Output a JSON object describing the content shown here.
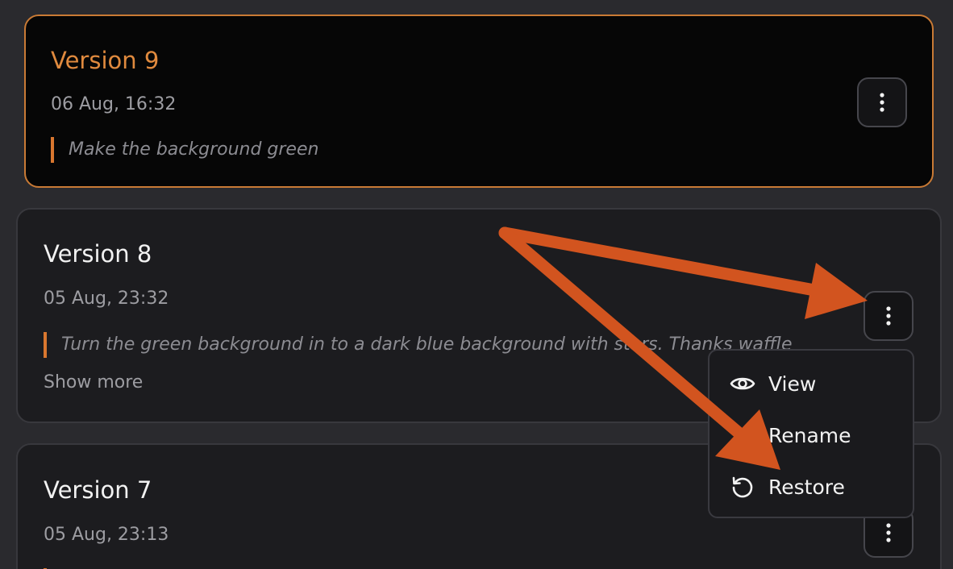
{
  "versions": [
    {
      "title": "Version 9",
      "date": "06 Aug, 16:32",
      "prompt": "Make the background green"
    },
    {
      "title": "Version 8",
      "date": "05 Aug, 23:32",
      "prompt": "Turn the green background in to a dark blue background with stars. Thanks waffle",
      "show_more": "Show more"
    },
    {
      "title": "Version 7",
      "date": "05 Aug, 23:13"
    }
  ],
  "menu": {
    "items": [
      {
        "label": "View",
        "icon": "eye-icon"
      },
      {
        "label": "Rename",
        "icon": "none"
      },
      {
        "label": "Restore",
        "icon": "restore-icon"
      }
    ]
  },
  "colors": {
    "accent": "#e08a3e",
    "annotation_arrow": "#d2541f",
    "background": "#2a2a2e",
    "card": "#1c1c1f"
  }
}
